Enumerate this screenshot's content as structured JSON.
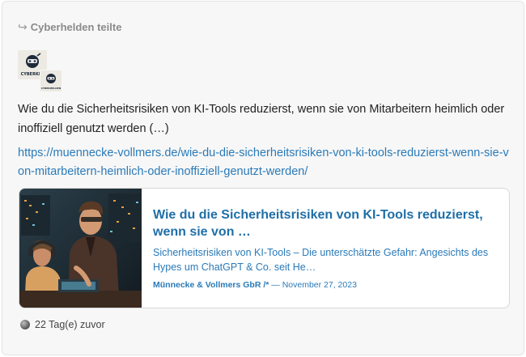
{
  "share": {
    "icon": "share-arrow-icon",
    "label": "Cyberhelden teilte"
  },
  "avatars": {
    "main_label": "CYBERKEL",
    "small_label": "CYBERHELDEN"
  },
  "post": {
    "text": "Wie du die Sicherheitsrisiken von KI-Tools reduzierst, wenn sie von Mitarbeitern heimlich oder inoffiziell genutzt werden (…)",
    "link": "https://muennecke-vollmers.de/wie-du-die-sicherheitsrisiken-von-ki-tools-reduzierst-wenn-sie-von-mitarbeitern-heimlich-oder-inoffiziell-genutzt-werden/"
  },
  "preview": {
    "title": "Wie du die Sicherheitsrisiken von KI-Tools reduzierst, wenn sie von …",
    "description": "Sicherheitsrisiken von KI-Tools – Die unterschätzte Gefahr: Angesichts des Hypes um ChatGPT & Co. seit He…",
    "author": "Münnecke & Vollmers GbR /*",
    "date_sep": " — ",
    "date": "November 27, 2023"
  },
  "footer": {
    "icon": "globe-icon",
    "time": "22 Tag(e) zuvor"
  },
  "colors": {
    "link": "#2a7ab8",
    "title": "#1f6fa8",
    "card_bg": "#f7f7f7"
  }
}
